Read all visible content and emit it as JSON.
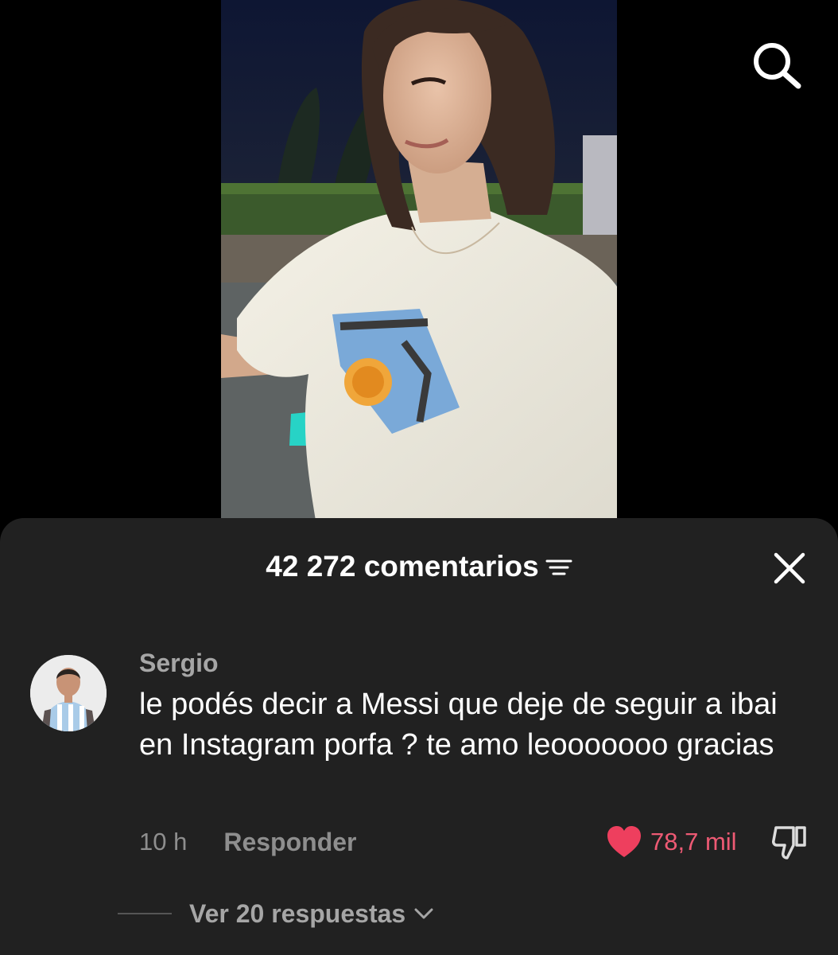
{
  "comments_sheet": {
    "count_label": "42 272 comentarios",
    "comment": {
      "username": "Sergio",
      "text": "le podés decir a Messi que deje de seguir a ibai en Instagram porfa ? te amo leooooooo gracias",
      "time": "10 h",
      "reply_label": "Responder",
      "likes": "78,7 mil",
      "view_replies_label": "Ver 20 respuestas"
    }
  },
  "colors": {
    "sheet_background": "#212121",
    "like_accent": "#ee5a74",
    "secondary_text": "#8e8e8e"
  },
  "icons": [
    "search-icon",
    "sort-icon",
    "close-icon",
    "heart-icon",
    "thumbs-down-icon",
    "chevron-down-icon"
  ]
}
